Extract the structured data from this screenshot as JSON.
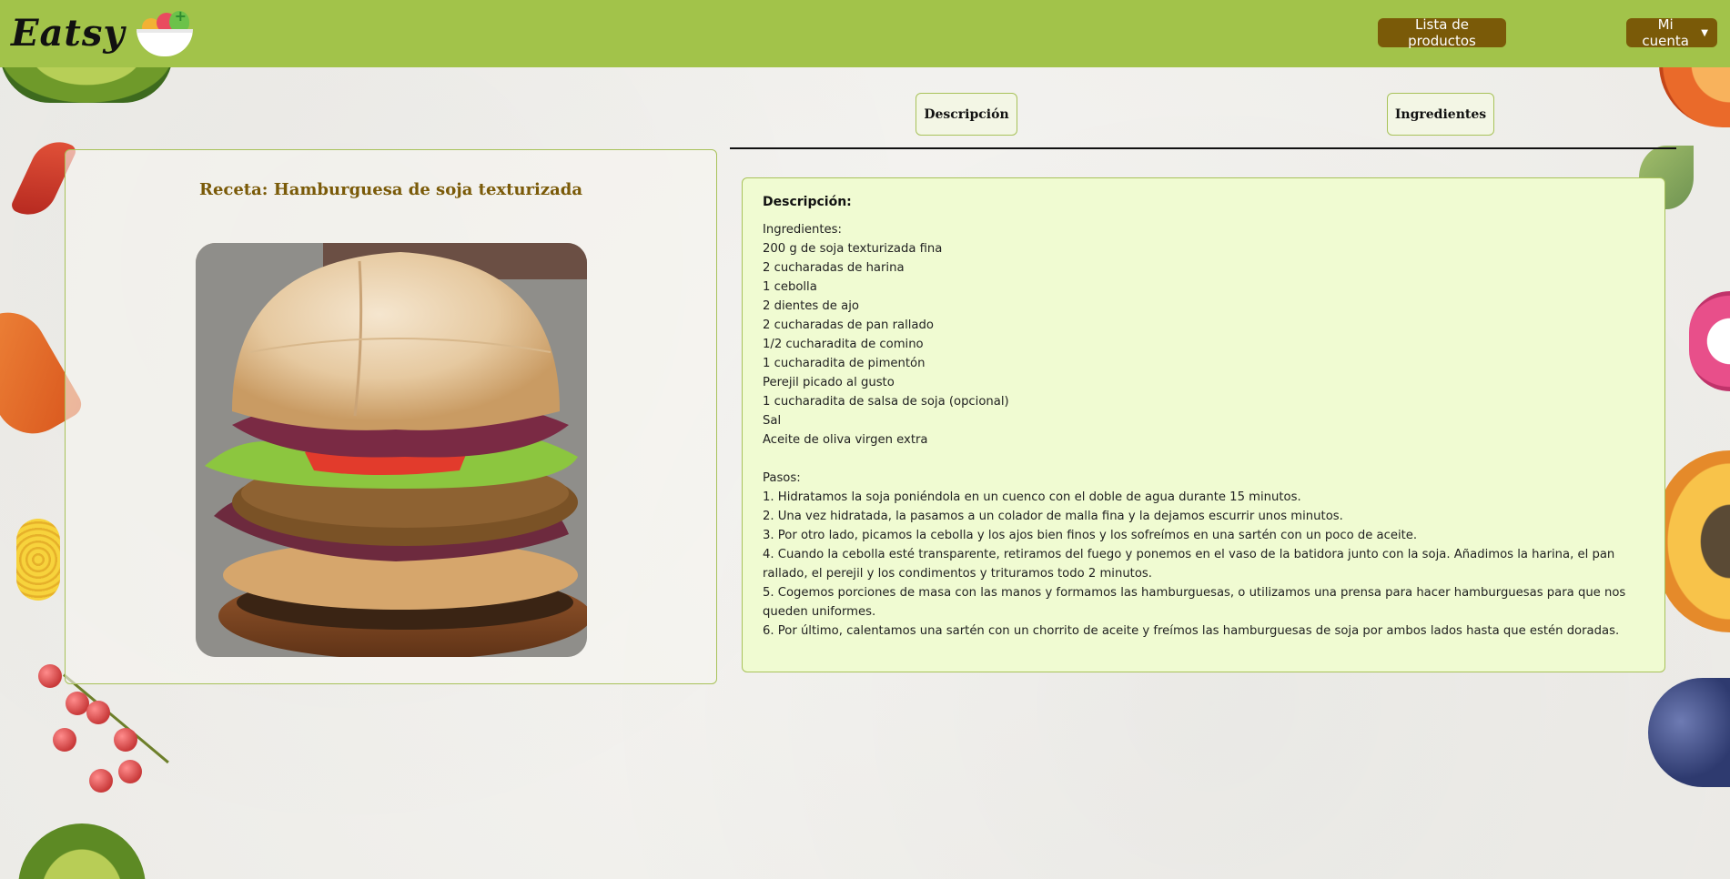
{
  "brand": {
    "name": "Eatsy",
    "logo_icon": "salad-bowl-icon"
  },
  "navbar": {
    "products_label": "Lista de productos",
    "account_label": "Mi cuenta",
    "bg_color": "#a2c34a",
    "button_color": "#7a5a08"
  },
  "tabs": [
    {
      "label": "Descripción"
    },
    {
      "label": "Ingredientes"
    }
  ],
  "recipe": {
    "title": "Receta: Hamburguesa de soja texturizada",
    "image_icon": "burger-photo"
  },
  "description": {
    "heading": "Descripción:",
    "ingredients_heading": "Ingredientes:",
    "ingredients": [
      "200 g de soja texturizada fina",
      "2 cucharadas de harina",
      "1 cebolla",
      "2 dientes de ajo",
      "2 cucharadas de pan rallado",
      "1/2 cucharadita de comino",
      "1 cucharadita de pimentón",
      "Perejil picado al gusto",
      "1 cucharadita de salsa de soja (opcional)",
      "Sal",
      "Aceite de oliva virgen extra"
    ],
    "steps_heading": "Pasos:",
    "steps": [
      "1. Hidratamos la soja poniéndola en un cuenco con el doble de agua durante 15 minutos.",
      "2. Una vez hidratada, la pasamos a un colador de malla fina y la dejamos escurrir unos minutos.",
      "3. Por otro lado, picamos la cebolla y los ajos bien finos y los sofreímos en una sartén con un poco de aceite.",
      "4. Cuando la cebolla esté transparente, retiramos del fuego y ponemos en el vaso de la batidora junto con la soja. Añadimos la harina, el pan rallado, el perejil y los condimentos y trituramos todo 2 minutos.",
      "5. Cogemos porciones de masa con las manos y formamos las hamburguesas, o utilizamos una prensa para hacer hamburguesas para que nos queden uniformes.",
      "6. Por último, calentamos una sartén con un chorrito de aceite y freímos las hamburguesas de soja por ambos lados hasta que estén doradas."
    ]
  },
  "colors": {
    "title_color": "#7a5a08",
    "card_border": "#a8c25a",
    "desc_bg": "#f0fbd2"
  }
}
